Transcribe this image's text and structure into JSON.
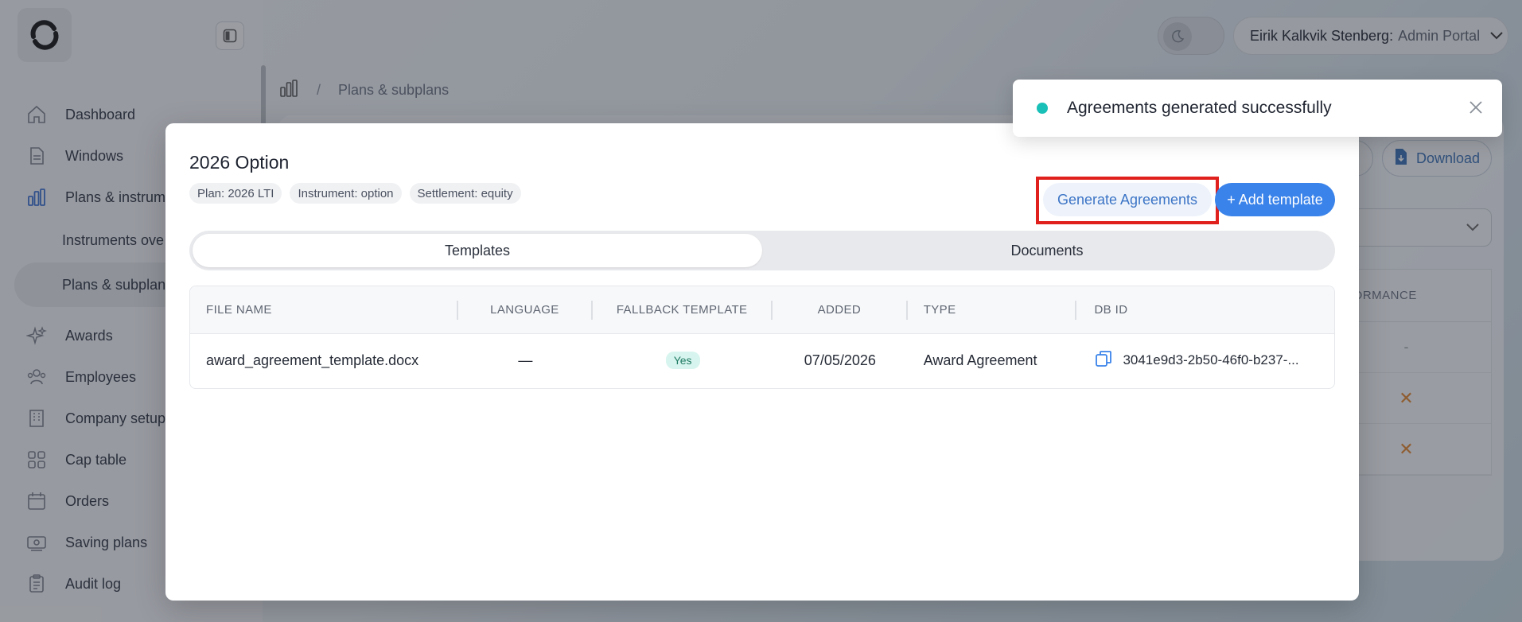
{
  "topbar": {
    "user_name": "Eirik Kalkvik Stenberg:",
    "user_role": "Admin Portal"
  },
  "sidebar": {
    "items": [
      {
        "label": "Dashboard"
      },
      {
        "label": "Windows"
      },
      {
        "label": "Plans & instrume"
      },
      {
        "label": "Instruments ove"
      },
      {
        "label": "Plans & subplans"
      },
      {
        "label": "Awards"
      },
      {
        "label": "Employees"
      },
      {
        "label": "Company setup"
      },
      {
        "label": "Cap table"
      },
      {
        "label": "Orders"
      },
      {
        "label": "Saving plans"
      },
      {
        "label": "Audit log"
      }
    ]
  },
  "breadcrumb": {
    "separator": "/",
    "current": "Plans & subplans"
  },
  "background": {
    "download_label": "Download",
    "table_header": "FORMANCE",
    "rows": [
      "-",
      "✕",
      "✕"
    ]
  },
  "modal": {
    "title": "2026 Option",
    "chips": [
      "Plan: 2026 LTI",
      "Instrument: option",
      "Settlement: equity"
    ],
    "generate_label": "Generate Agreements",
    "add_label": "+ Add template",
    "tabs": [
      "Templates",
      "Documents"
    ],
    "table": {
      "headers": [
        "FILE NAME",
        "LANGUAGE",
        "FALLBACK TEMPLATE",
        "ADDED",
        "TYPE",
        "DB ID"
      ],
      "rows": [
        {
          "file_name": "award_agreement_template.docx",
          "language": "—",
          "fallback": "Yes",
          "added": "07/05/2026",
          "type": "Award Agreement",
          "db_id": "3041e9d3-2b50-46f0-b237-..."
        }
      ]
    }
  },
  "toast": {
    "message": "Agreements generated successfully",
    "color": "#19c0b7"
  }
}
